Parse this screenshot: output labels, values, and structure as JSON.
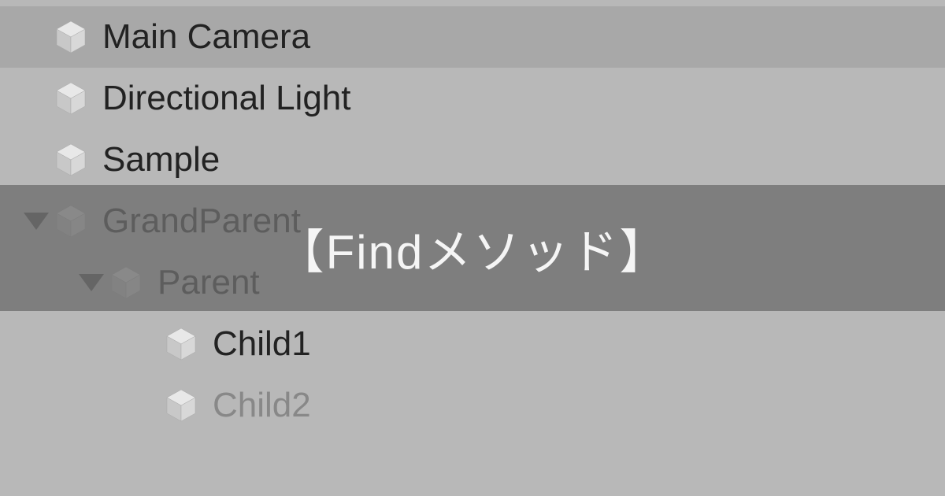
{
  "hierarchy": {
    "items": [
      {
        "name": "Main Camera",
        "indent": 0,
        "hasArrow": false,
        "selected": true,
        "dimmed": false
      },
      {
        "name": "Directional Light",
        "indent": 0,
        "hasArrow": false,
        "selected": false,
        "dimmed": false
      },
      {
        "name": "Sample",
        "indent": 0,
        "hasArrow": false,
        "selected": false,
        "dimmed": false
      },
      {
        "name": "GrandParent",
        "indent": 0,
        "hasArrow": true,
        "selected": false,
        "dimmed": false
      },
      {
        "name": "Parent",
        "indent": 1,
        "hasArrow": true,
        "selected": false,
        "dimmed": false
      },
      {
        "name": "Child1",
        "indent": 2,
        "hasArrow": false,
        "selected": false,
        "dimmed": false
      },
      {
        "name": "Child2",
        "indent": 2,
        "hasArrow": false,
        "selected": false,
        "dimmed": true
      }
    ]
  },
  "overlay": {
    "title": "【Findメソッド】"
  }
}
